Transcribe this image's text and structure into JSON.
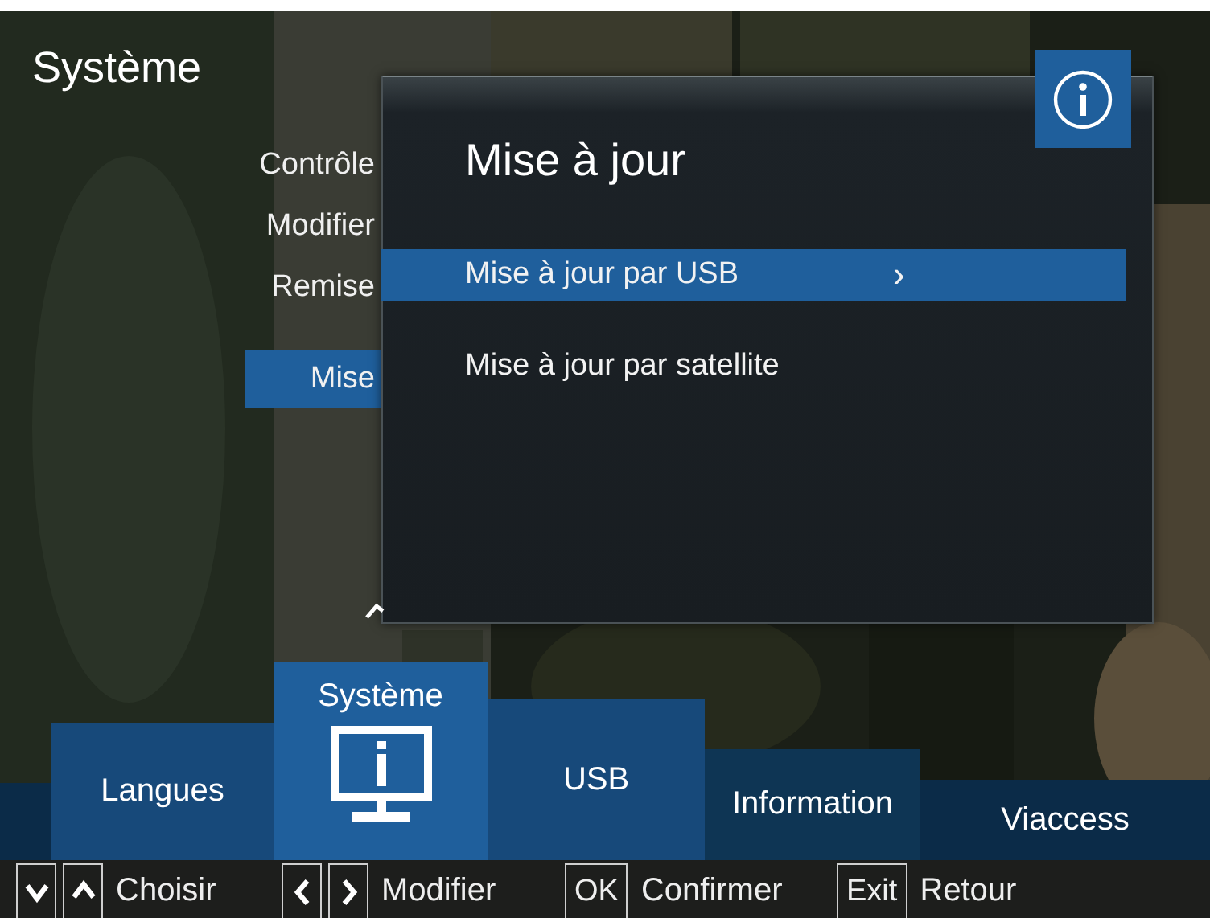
{
  "title": "Système",
  "menu": [
    {
      "label": "Contrôle",
      "selected": false
    },
    {
      "label": "Modifier",
      "selected": false
    },
    {
      "label": "Remise",
      "selected": false
    },
    {
      "label": "Mise",
      "selected": true
    }
  ],
  "dialog": {
    "title": "Mise à jour",
    "items": [
      {
        "label": "Mise à jour par USB",
        "selected": true,
        "chevron": "›"
      },
      {
        "label": "Mise à jour par satellite",
        "selected": false
      }
    ]
  },
  "tabs": [
    {
      "label": "Langues",
      "selected": false
    },
    {
      "label": "Système",
      "selected": true
    },
    {
      "label": "USB",
      "selected": false
    },
    {
      "label": "Information",
      "selected": false
    },
    {
      "label": "Viaccess",
      "selected": false
    }
  ],
  "hints": [
    {
      "keys": [
        {
          "kind": "chevron-down"
        },
        {
          "kind": "chevron-up"
        }
      ],
      "label": "Choisir"
    },
    {
      "keys": [
        {
          "kind": "chevron-left"
        },
        {
          "kind": "chevron-right"
        }
      ],
      "label": "Modifier"
    },
    {
      "keys": [
        {
          "kind": "text",
          "text": "OK"
        }
      ],
      "label": "Confirmer"
    },
    {
      "keys": [
        {
          "kind": "text",
          "text": "Exit"
        }
      ],
      "label": "Retour"
    }
  ]
}
